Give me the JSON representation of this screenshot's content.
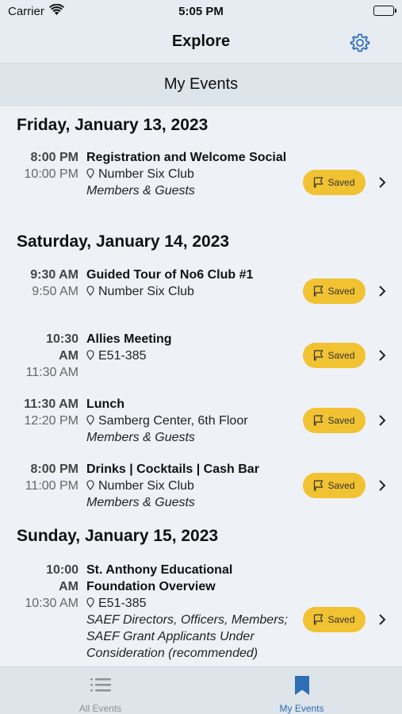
{
  "status_bar": {
    "carrier": "Carrier",
    "time": "5:05 PM"
  },
  "nav": {
    "title": "Explore",
    "settings_icon": "gear-icon"
  },
  "section": {
    "title": "My Events"
  },
  "saved_label": "Saved",
  "days": [
    {
      "date": "Friday, January 13, 2023",
      "events": [
        {
          "start": "8:00 PM",
          "end": "10:00 PM",
          "name": "Registration and Welcome Social",
          "location": "Number Six Club",
          "audience": "Members & Guests"
        }
      ]
    },
    {
      "date": "Saturday, January 14, 2023",
      "events": [
        {
          "start": "9:30 AM",
          "end": "9:50 AM",
          "name": "Guided Tour of No6 Club #1",
          "location": "Number Six Club",
          "audience": ""
        },
        {
          "start": "10:30 AM",
          "end": "11:30 AM",
          "name": "Allies Meeting",
          "location": "E51-385",
          "audience": ""
        },
        {
          "start": "11:30 AM",
          "end": "12:20 PM",
          "name": "Lunch",
          "location": "Samberg Center, 6th Floor",
          "audience": "Members & Guests"
        },
        {
          "start": "8:00 PM",
          "end": "11:00 PM",
          "name": "Drinks | Cocktails | Cash Bar",
          "location": "Number Six Club",
          "audience": "Members & Guests"
        }
      ]
    },
    {
      "date": "Sunday, January 15, 2023",
      "events": [
        {
          "start": "10:00 AM",
          "end": "10:30 AM",
          "name": "St. Anthony Educational Foundation Overview",
          "location": "E51-385",
          "audience": "SAEF Directors, Officers, Members; SAEF Grant Applicants Under Consideration (recommended)"
        }
      ]
    }
  ],
  "tabs": [
    {
      "label": "All Events",
      "icon": "list-icon",
      "active": false
    },
    {
      "label": "My Events",
      "icon": "bookmark-icon",
      "active": true
    }
  ],
  "colors": {
    "accent": "#2f6db5",
    "saved_badge": "#f1c232",
    "background": "#eef2f6"
  }
}
